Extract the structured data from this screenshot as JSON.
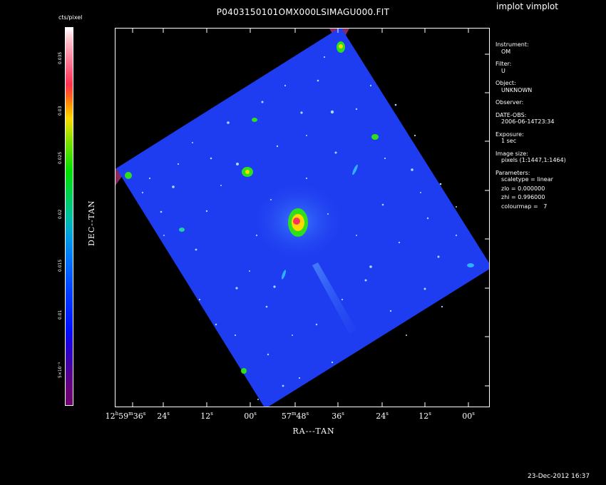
{
  "window": {
    "app_name": "implot vimplot",
    "title": "P0403150101OMX000LSIMAGU000.FIT",
    "timestamp": "23-Dec-2012 16:37"
  },
  "colorbar": {
    "unit": "cts/pixel",
    "ticks": [
      "5×10⁻³",
      "0.01",
      "0.015",
      "0.02",
      "0.025",
      "0.03",
      "0.035"
    ],
    "colormap": "rainbow"
  },
  "axes": {
    "xlabel": "RA---TAN",
    "ylabel": "DEC--TAN",
    "xticks": [
      {
        "h": "12",
        "m": "59",
        "s": "36"
      },
      {
        "s": "24"
      },
      {
        "s": "12"
      },
      {
        "s": "00"
      },
      {
        "m": "57",
        "s": "48"
      },
      {
        "s": "36"
      },
      {
        "s": "24"
      },
      {
        "s": "12"
      },
      {
        "s": "00"
      }
    ]
  },
  "info": [
    {
      "label": "Instrument:",
      "value": "OM"
    },
    {
      "label": "Filter:",
      "value": "U"
    },
    {
      "label": "Object:",
      "value": "UNKNOWN"
    },
    {
      "label": "Observer:",
      "value": ""
    },
    {
      "label": "DATE-OBS:",
      "value": "2006-06-14T23:34"
    },
    {
      "label": "Exposure:",
      "value": "1 sec"
    },
    {
      "label": "Image size:",
      "value": "pixels (1:1447,1:1464)"
    }
  ],
  "parameters": {
    "label": "Parameters:",
    "lines": [
      "scaletype = linear",
      "zlo = 0.000000",
      "zhi = 0.996000",
      "colourmap =   7"
    ]
  },
  "colors": {
    "background": "#000000",
    "sky": "#1e3cf0",
    "corner": "#8a2a5a"
  }
}
